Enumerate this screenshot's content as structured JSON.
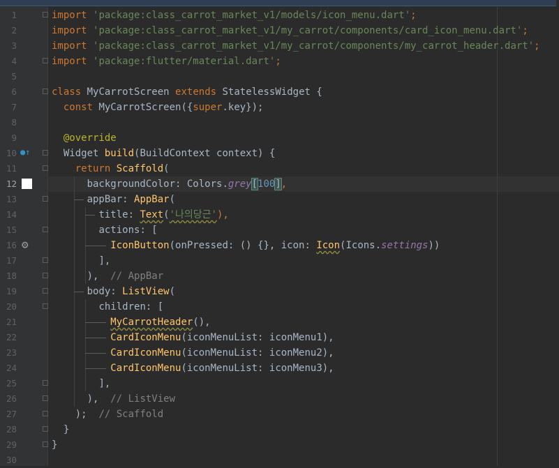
{
  "editor": {
    "current_line": 12,
    "line_numbers": [
      "1",
      "2",
      "3",
      "4",
      "5",
      "6",
      "7",
      "8",
      "9",
      "10",
      "11",
      "12",
      "13",
      "14",
      "15",
      "16",
      "17",
      "18",
      "19",
      "20",
      "21",
      "22",
      "23",
      "24",
      "25",
      "26",
      "27",
      "28",
      "29",
      "30"
    ],
    "icons": {
      "override": "override-gutter-icon",
      "gear": "settings-gutter-icon",
      "color": "color-preview-icon"
    },
    "lines": {
      "l1": {
        "kw": "import",
        "str": "'package:class_carrot_market_v1/models/icon_menu.dart'",
        "semi": ";"
      },
      "l2": {
        "kw": "import",
        "str": "'package:class_carrot_market_v1/my_carrot/components/card_icon_menu.dart'",
        "semi": ";"
      },
      "l3": {
        "kw": "import",
        "str": "'package:class_carrot_market_v1/my_carrot/components/my_carrot_header.dart'",
        "semi": ";"
      },
      "l4": {
        "kw": "import",
        "str": "'package:flutter/material.dart'",
        "semi": ";"
      },
      "l6": {
        "kw1": "class",
        "name": "MyCarrotScreen",
        "kw2": "extends",
        "sup": "StatelessWidget {"
      },
      "l7": {
        "kw": "const",
        "name": "MyCarrotScreen({",
        "sup": "super",
        "rest": ".key});"
      },
      "l9": {
        "ann": "@override"
      },
      "l10": {
        "t1": "Widget",
        "fn": "build",
        "t2": "(BuildContext context) {"
      },
      "l11": {
        "kw": "return",
        "cls": "Scaffold",
        "t": "("
      },
      "l12": {
        "a": "backgroundColor: Colors.",
        "fld": "grey",
        "b": "[",
        "num": "100",
        "c": "]",
        ",": ","
      },
      "l13": {
        "a": "appBar: ",
        "cls": "AppBar",
        "b": "("
      },
      "l14": {
        "a": "title: ",
        "cls": "Text",
        "b": "(",
        "str": "'나의당근'",
        "c": "),"
      },
      "l15": {
        "a": "actions: ["
      },
      "l16": {
        "cls": "IconButton",
        "a": "(onPressed: () {}, icon: ",
        "cls2": "Icon",
        "b": "(Icons.",
        "fld": "settings",
        "c": "))"
      },
      "l17": {
        "a": "],"
      },
      "l18": {
        "a": "),",
        "cmt": "// AppBar"
      },
      "l19": {
        "a": "body: ",
        "cls": "ListView",
        "b": "("
      },
      "l20": {
        "a": "children: ["
      },
      "l21": {
        "cls": "MyCarrotHeader",
        "a": "(),"
      },
      "l22": {
        "cls": "CardIconMenu",
        "a": "(iconMenuList: iconMenu1),"
      },
      "l23": {
        "cls": "CardIconMenu",
        "a": "(iconMenuList: iconMenu2),"
      },
      "l24": {
        "cls": "CardIconMenu",
        "a": "(iconMenuList: iconMenu3),"
      },
      "l25": {
        "a": "],"
      },
      "l26": {
        "a": "),",
        "cmt": "// ListView"
      },
      "l27": {
        "a": ");",
        "cmt": "// Scaffold"
      },
      "l28": {
        "a": "}"
      },
      "l29": {
        "a": "}"
      }
    }
  }
}
